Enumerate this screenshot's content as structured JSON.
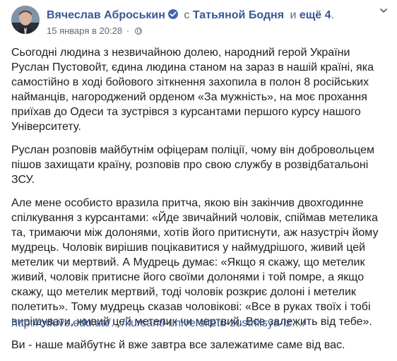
{
  "post": {
    "author_name": "Вячеслав Аброськин",
    "with_prefix": "с",
    "with_person": "Татьяной Бодня",
    "with_and": "и",
    "with_others": "ещё 4",
    "timestamp": "15 января в 20:28",
    "separator": "·",
    "icons": {
      "verified": "verified-badge-icon",
      "privacy": "globe-icon",
      "menu": "chevron-down-icon"
    },
    "accent_color": "#385898",
    "paragraphs": [
      "Сьогодні людина з незвичайною долею, народний герой України Руслан Пустовойт, єдина людина станом на зараз в нашій країні, яка самостійно в ході бойового зіткнення захопила в полон 8 російських найманців, нагороджений орденом «За мужність», на моє прохання приїхав до Одеси та зустрівся з курсантами першого курсу нашого Університету.",
      "Руслан розповів майбутнім офіцерам поліції, чому він добровольцем пішов захищати країну, розповів про свою службу в розвідбатальоні ЗСУ.",
      "Але мене особисто вразила притча, якою він закінчив двохгодинне спілкування з курсантами: «Йде звичайний чоловік, спіймав метелика та, тримаючи між долонями, хотів його притиснути, аж назустріч йому мудрець. Чоловік вирішив поцікавитися у наймудрішого, живий цей метелик чи мертвий. А Мудрець думає: «Якщо я скажу, що метелик живий, чоловік притисне його своїми долонями і той помре, а якщо скажу, що метелик мертвий, тоді чоловік розкриє долоні і метелик полетить». Тому мудрець сказав чоловікові: «Все в руках твоїх і тобі вирішувати, живий цей метелик чи мертвий. Все залежить від тебе».",
      "Ви - наше майбутнє й вже завтра все залежатиме саме від вас."
    ],
    "link": "http://oduvs.edu.ua/…/kursanti-universitetu-zustrilisya-iz…/"
  }
}
